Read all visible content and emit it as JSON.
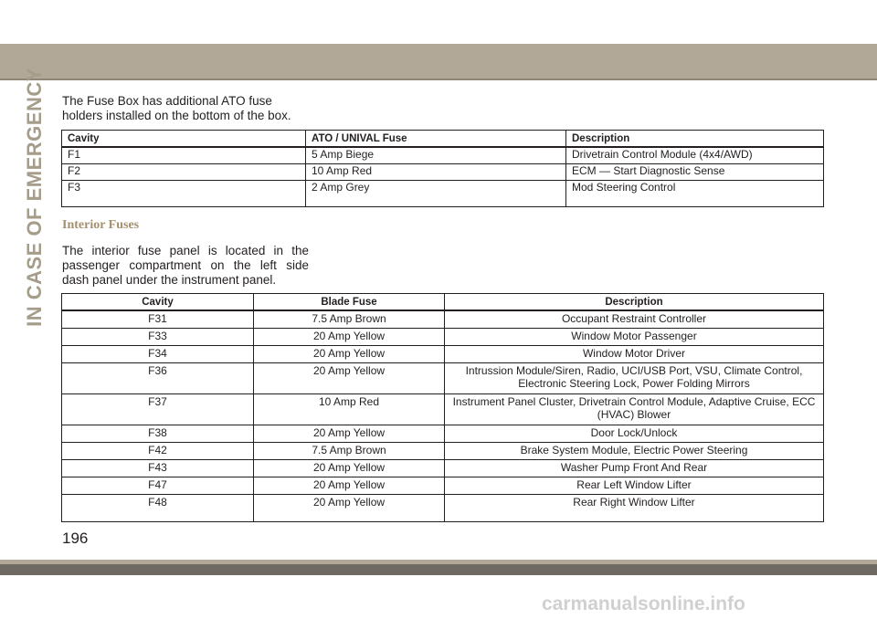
{
  "section_tab": "IN CASE OF EMERGENCY",
  "intro_text": "The Fuse Box has additional ATO fuse holders installed on the bottom of the box.",
  "ato_table": {
    "headers": [
      "Cavity",
      "ATO / UNIVAL Fuse",
      "Description"
    ],
    "rows": [
      [
        "F1",
        "5 Amp Biege",
        "Drivetrain Control Module (4x4/AWD)"
      ],
      [
        "F2",
        "10 Amp Red",
        "ECM — Start Diagnostic Sense"
      ],
      [
        "F3",
        "2 Amp Grey",
        "Mod Steering Control"
      ]
    ]
  },
  "interior_heading": "Interior Fuses",
  "interior_text": "The interior fuse panel is located in the passenger compartment on the left side dash panel under the instrument panel.",
  "interior_table": {
    "headers": [
      "Cavity",
      "Blade Fuse",
      "Description"
    ],
    "rows": [
      [
        "F31",
        "7.5 Amp Brown",
        "Occupant Restraint Controller"
      ],
      [
        "F33",
        "20 Amp Yellow",
        "Window Motor Passenger"
      ],
      [
        "F34",
        "20 Amp Yellow",
        "Window Motor Driver"
      ],
      [
        "F36",
        "20 Amp Yellow",
        "Intrussion Module/Siren, Radio, UCI/USB Port, VSU, Climate Control, Electronic Steering Lock, Power Folding Mirrors"
      ],
      [
        "F37",
        "10 Amp Red",
        "Instrument Panel Cluster, Drivetrain Control Module, Adaptive Cruise, ECC (HVAC) Blower"
      ],
      [
        "F38",
        "20 Amp Yellow",
        "Door Lock/Unlock"
      ],
      [
        "F42",
        "7.5 Amp Brown",
        "Brake System Module, Electric Power Steering"
      ],
      [
        "F43",
        "20 Amp Yellow",
        "Washer Pump Front And Rear"
      ],
      [
        "F47",
        "20 Amp Yellow",
        "Rear Left Window Lifter"
      ],
      [
        "F48",
        "20 Amp Yellow",
        "Rear Right Window Lifter"
      ]
    ]
  },
  "page_number": "196",
  "watermark": "carmanualsonline.info",
  "colors": {
    "band": "#b1a898",
    "band_dark": "#6e6a63",
    "side_tab": "#a59c89",
    "heading": "#a4906d",
    "text": "#231f20"
  }
}
